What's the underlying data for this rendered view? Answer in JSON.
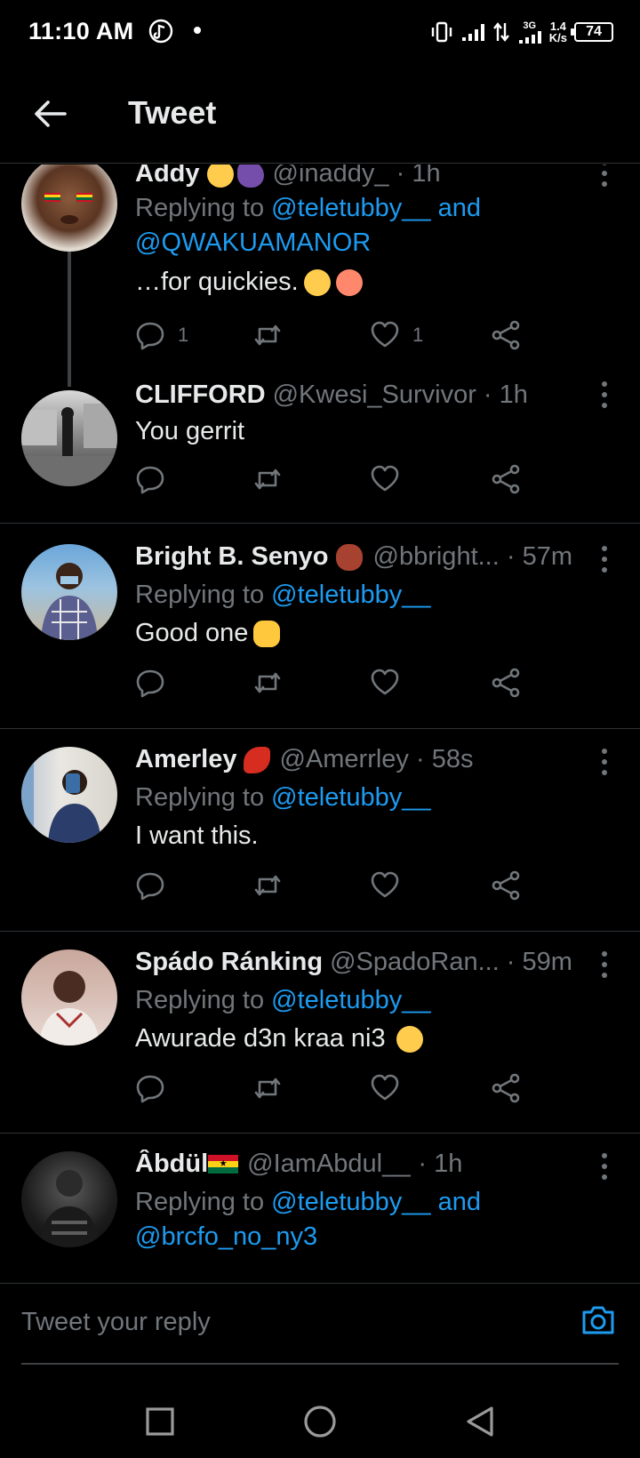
{
  "status_bar": {
    "time": "11:10 AM",
    "net_3g": "3G",
    "net_speed_value": "1.4",
    "net_speed_unit": "K/s",
    "battery": "74"
  },
  "header": {
    "title": "Tweet"
  },
  "tweets": [
    {
      "name": "Addy",
      "handle": "@inaddy_",
      "time": "1h",
      "reply_prefix": "Replying to ",
      "reply_line1": "@teletubby__ and",
      "reply_line2": "@QWAKUAMANOR",
      "text": "…for quickies.",
      "replies": "1",
      "likes": "1"
    },
    {
      "name": "CLIFFORD",
      "handle": "@Kwesi_Survivor",
      "time": "1h",
      "text": "You gerrit"
    },
    {
      "name": "Bright B. Senyo",
      "handle": "@bbright...",
      "time": "57m",
      "reply_prefix": "Replying to ",
      "reply_line1": "@teletubby__",
      "text": "Good one"
    },
    {
      "name": "Amerley",
      "handle": "@Amerrley",
      "time": "58s",
      "reply_prefix": "Replying to ",
      "reply_line1": "@teletubby__",
      "text": "I want this."
    },
    {
      "name": "Spádo Ránking",
      "handle": "@SpadoRan...",
      "time": "59m",
      "reply_prefix": "Replying to ",
      "reply_line1": "@teletubby__",
      "text": "Awurade d3n kraa ni3"
    },
    {
      "name": "Âbdül",
      "handle": "@IamAbdul__",
      "time": "1h",
      "reply_prefix": "Replying to ",
      "reply_line1": "@teletubby__ and",
      "reply_line2": "@brcfo_no_ny3"
    }
  ],
  "compose": {
    "placeholder": "Tweet your reply"
  },
  "colors": {
    "background": "#000000",
    "link": "#1d9bf0",
    "muted": "#71767b",
    "divider": "#2f3336"
  },
  "icons": {
    "reply": "speech-bubble",
    "retweet": "retweet-arrows",
    "like": "heart",
    "share": "share-nodes",
    "camera": "camera",
    "back": "arrow-left"
  }
}
